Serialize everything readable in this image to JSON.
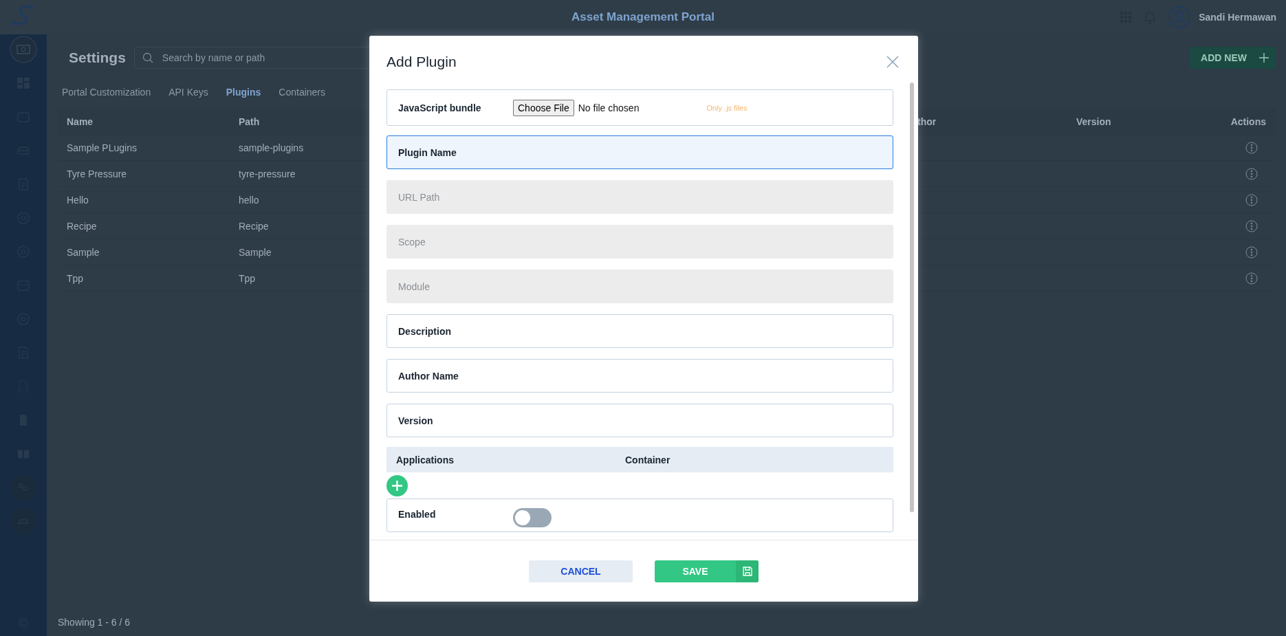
{
  "header": {
    "title": "Asset Management Portal",
    "user_name": "Sandi Hermawan"
  },
  "settings": {
    "title": "Settings",
    "search": {
      "placeholder": "Search by name or path"
    },
    "add_button": "ADD NEW",
    "tabs": [
      {
        "label": "Portal Customization",
        "selected": false
      },
      {
        "label": "API Keys",
        "selected": false
      },
      {
        "label": "Plugins",
        "selected": true
      },
      {
        "label": "Containers",
        "selected": false
      }
    ],
    "table": {
      "columns": [
        "Name",
        "Path",
        "thor",
        "Version",
        "Actions"
      ],
      "rows": [
        {
          "name": "Sample PLugins",
          "path": "sample-plugins"
        },
        {
          "name": "Tyre Pressure",
          "path": "tyre-pressure"
        },
        {
          "name": "Hello",
          "path": "hello"
        },
        {
          "name": "Recipe",
          "path": "Recipe"
        },
        {
          "name": "Sample",
          "path": "Sample"
        },
        {
          "name": "Tpp",
          "path": "Tpp"
        }
      ]
    },
    "pagination": "Showing 1 - 6 / 6"
  },
  "dialog": {
    "title": "Add Plugin",
    "fields": [
      {
        "kind": "file",
        "label": "JavaScript bundle",
        "button": "Choose File",
        "status": "No file chosen",
        "hint": "Only .js files"
      },
      {
        "kind": "text",
        "label": "Plugin Name",
        "focused": true,
        "disabled": false
      },
      {
        "kind": "text",
        "label": "URL Path",
        "focused": false,
        "disabled": true
      },
      {
        "kind": "text",
        "label": "Scope",
        "focused": false,
        "disabled": true
      },
      {
        "kind": "text",
        "label": "Module",
        "focused": false,
        "disabled": true
      },
      {
        "kind": "text",
        "label": "Description",
        "focused": false,
        "disabled": false
      },
      {
        "kind": "text",
        "label": "Author Name",
        "focused": false,
        "disabled": false
      },
      {
        "kind": "text",
        "label": "Version",
        "focused": false,
        "disabled": false
      }
    ],
    "applications_table": {
      "columns": [
        "Applications",
        "Container"
      ]
    },
    "enabled": {
      "label": "Enabled",
      "on": false
    },
    "buttons": {
      "cancel": "CANCEL",
      "save": "SAVE"
    }
  }
}
